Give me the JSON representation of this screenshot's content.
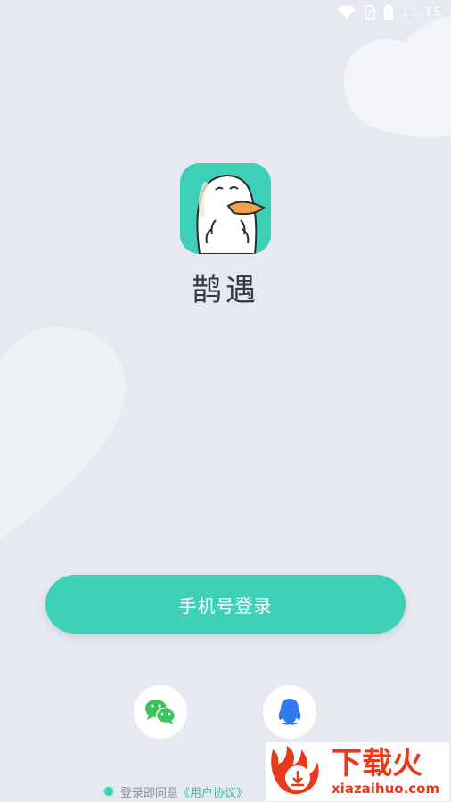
{
  "status_bar": {
    "time": "11:15"
  },
  "app": {
    "name": "鹊遇"
  },
  "login": {
    "phone_button_label": "手机号登录"
  },
  "social": {
    "wechat_icon": "wechat-icon",
    "qq_icon": "qq-icon"
  },
  "agreement": {
    "prefix": "登录即同意",
    "user_agreement_link": "《用户协议》"
  },
  "watermark": {
    "title": "下载火",
    "url": "xiazaihuo.com"
  },
  "colors": {
    "accent": "#3fd1b8",
    "background": "#e6e9ef",
    "watermark_red": "#e8391b"
  }
}
